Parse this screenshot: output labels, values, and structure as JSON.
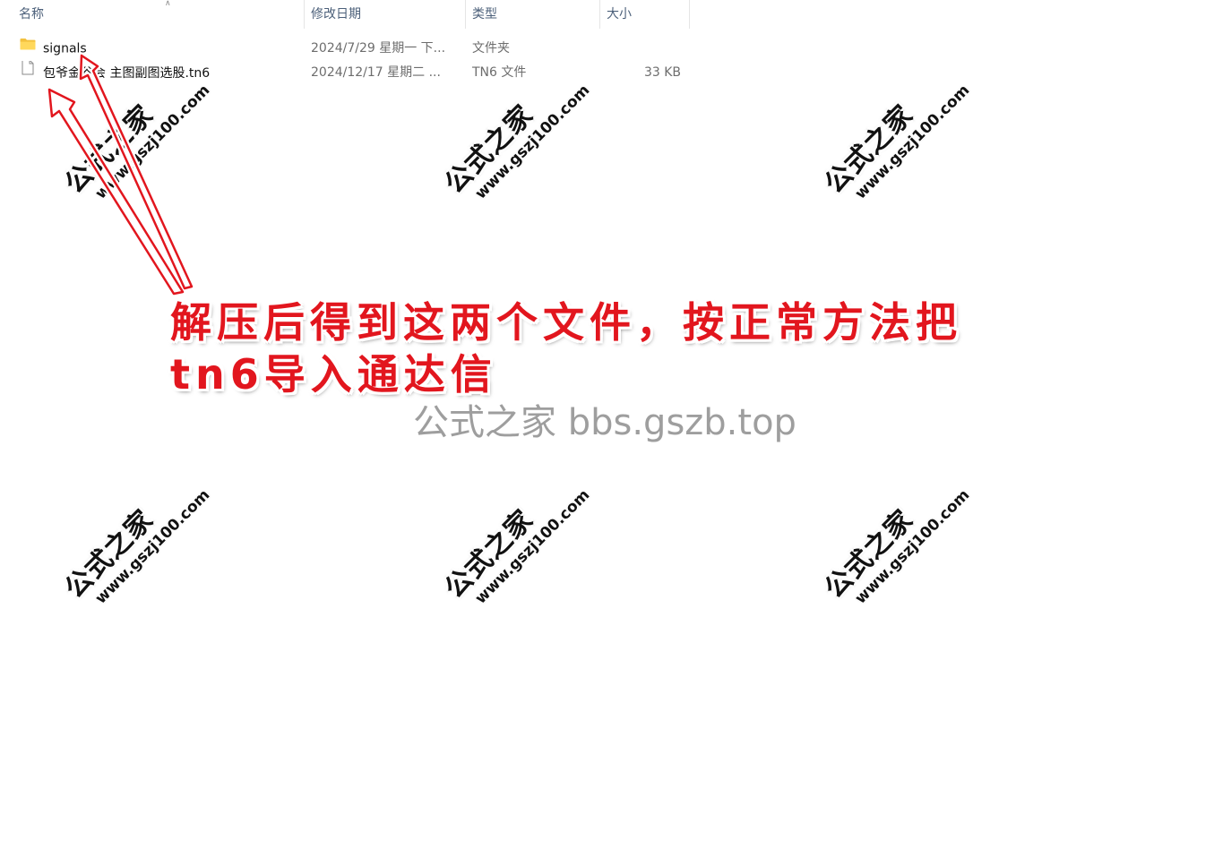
{
  "columns": {
    "name": "名称",
    "date": "修改日期",
    "type": "类型",
    "size": "大小"
  },
  "files": [
    {
      "name": "signals",
      "date": "2024/7/29 星期一 下...",
      "type": "文件夹",
      "size": "",
      "icon": "folder-icon"
    },
    {
      "name": "包爷金谷会 主图副图选股.tn6",
      "date": "2024/12/17 星期二 ...",
      "type": "TN6 文件",
      "size": "33 KB",
      "icon": "file-icon"
    }
  ],
  "watermark": {
    "title": "公式之家",
    "url": "www.gszj100.com"
  },
  "annotation": {
    "line1": "解压后得到这两个文件，按正常方法把",
    "line2": "tn6导入通达信",
    "color": "#e2161e"
  },
  "site_watermark": "公式之家 bbs.gszb.top",
  "colors": {
    "folder": "#f3c13e",
    "header_text": "#4c607a",
    "arrow": "#e2161e"
  }
}
